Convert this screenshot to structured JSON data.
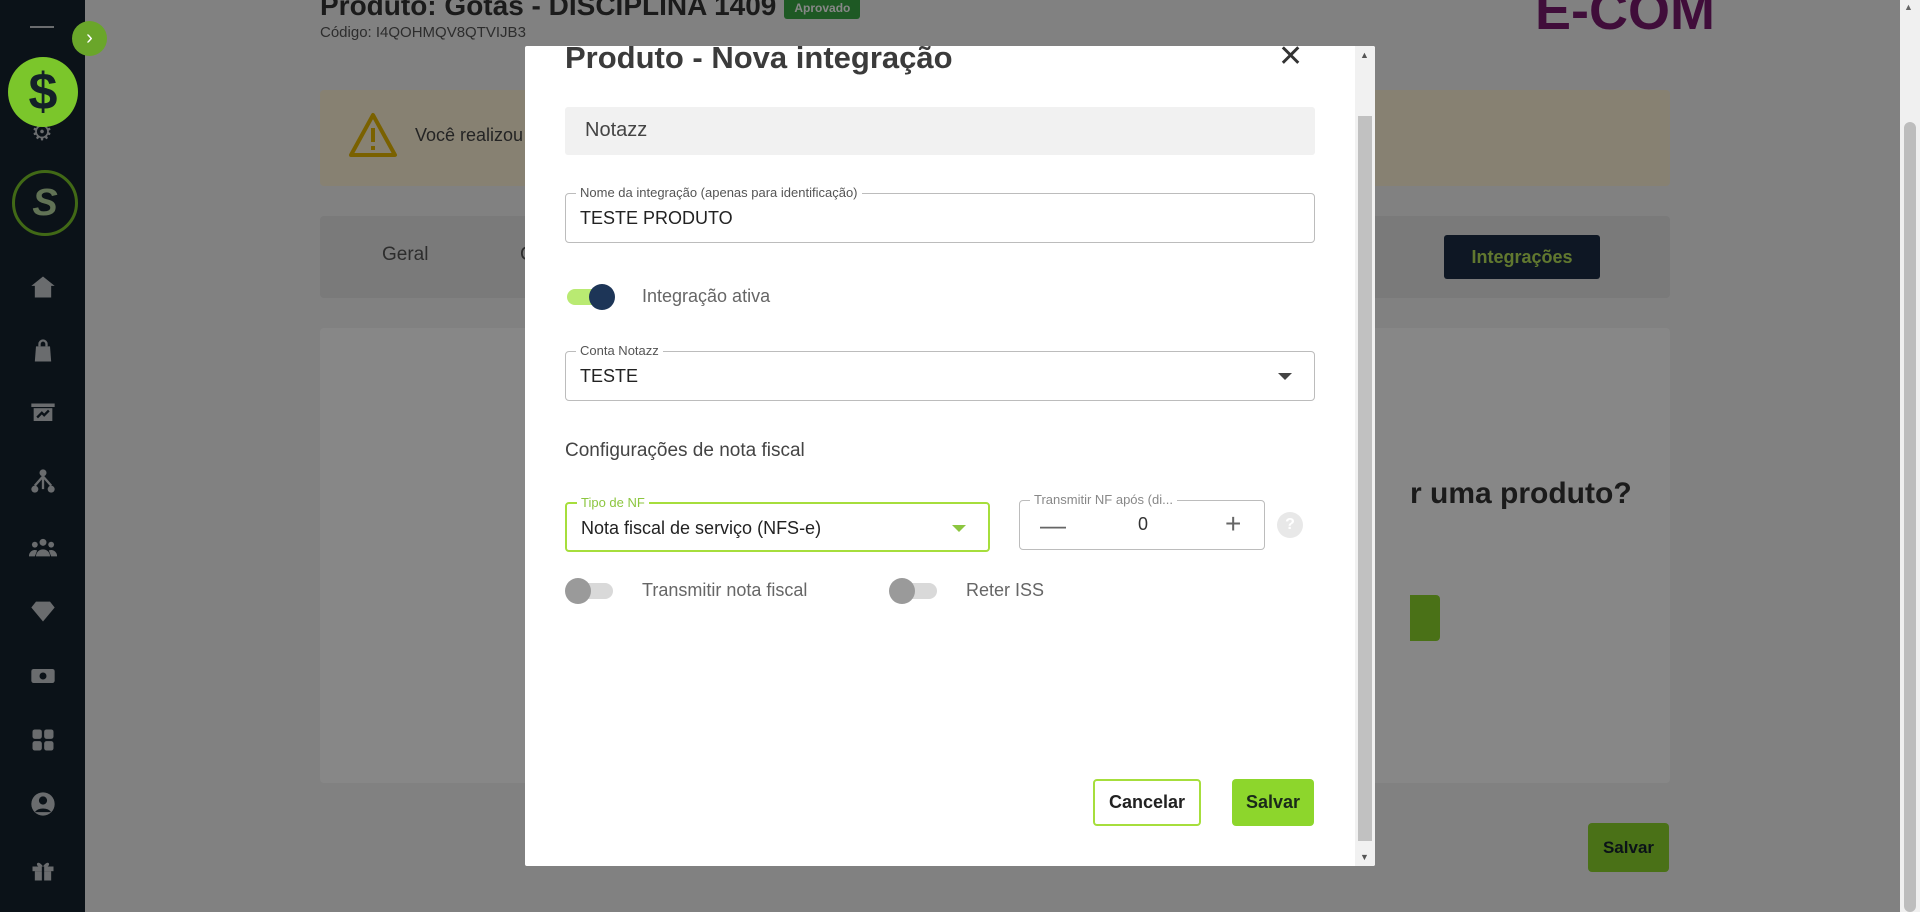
{
  "background": {
    "page_title": "Produto: Gotas - DISCIPLINA 1409",
    "status_badge": "Aprovado",
    "code_text": "Código: I4QOHMQV8QTVIJB3",
    "brand_text": "E-COM",
    "warning_text": "Você realizou",
    "tabs": [
      {
        "label": "Geral"
      },
      {
        "label": "C"
      },
      {
        "label": "Integrações"
      }
    ],
    "question_text": "r uma produto?",
    "save_label": "Salvar"
  },
  "sidebar": {
    "toggle_glyph": "›",
    "dollar_glyph": "$",
    "logo_glyph": "S",
    "icons": [
      "home-icon",
      "bag-icon",
      "presentation-icon",
      "network-icon",
      "users-icon",
      "diamond-icon",
      "money-icon",
      "apps-icon",
      "user-icon",
      "gift-icon"
    ]
  },
  "modal": {
    "title": "Produto - Nova integração",
    "close_glyph": "✕",
    "provider": "Notazz",
    "integration_name": {
      "label": "Nome da integração (apenas para identificação)",
      "value": "TESTE PRODUTO"
    },
    "active_toggle": {
      "label": "Integração ativa",
      "on": true
    },
    "account": {
      "label": "Conta Notazz",
      "value": "TESTE"
    },
    "section_title": "Configurações de nota fiscal",
    "nf_type": {
      "label": "Tipo de NF",
      "value": "Nota fiscal de serviço (NFS-e)"
    },
    "transmit_after": {
      "label": "Transmitir NF após (di...",
      "value": "0",
      "minus": "—",
      "plus": "+"
    },
    "help_glyph": "?",
    "transmit_toggle": {
      "label": "Transmitir nota fiscal",
      "on": false
    },
    "retain_toggle": {
      "label": "Reter ISS",
      "on": false
    },
    "cancel_label": "Cancelar",
    "save_label": "Salvar"
  },
  "colors": {
    "accent_green": "#8dd62c",
    "sidebar_bg": "#16232e",
    "navy": "#1d3557"
  }
}
